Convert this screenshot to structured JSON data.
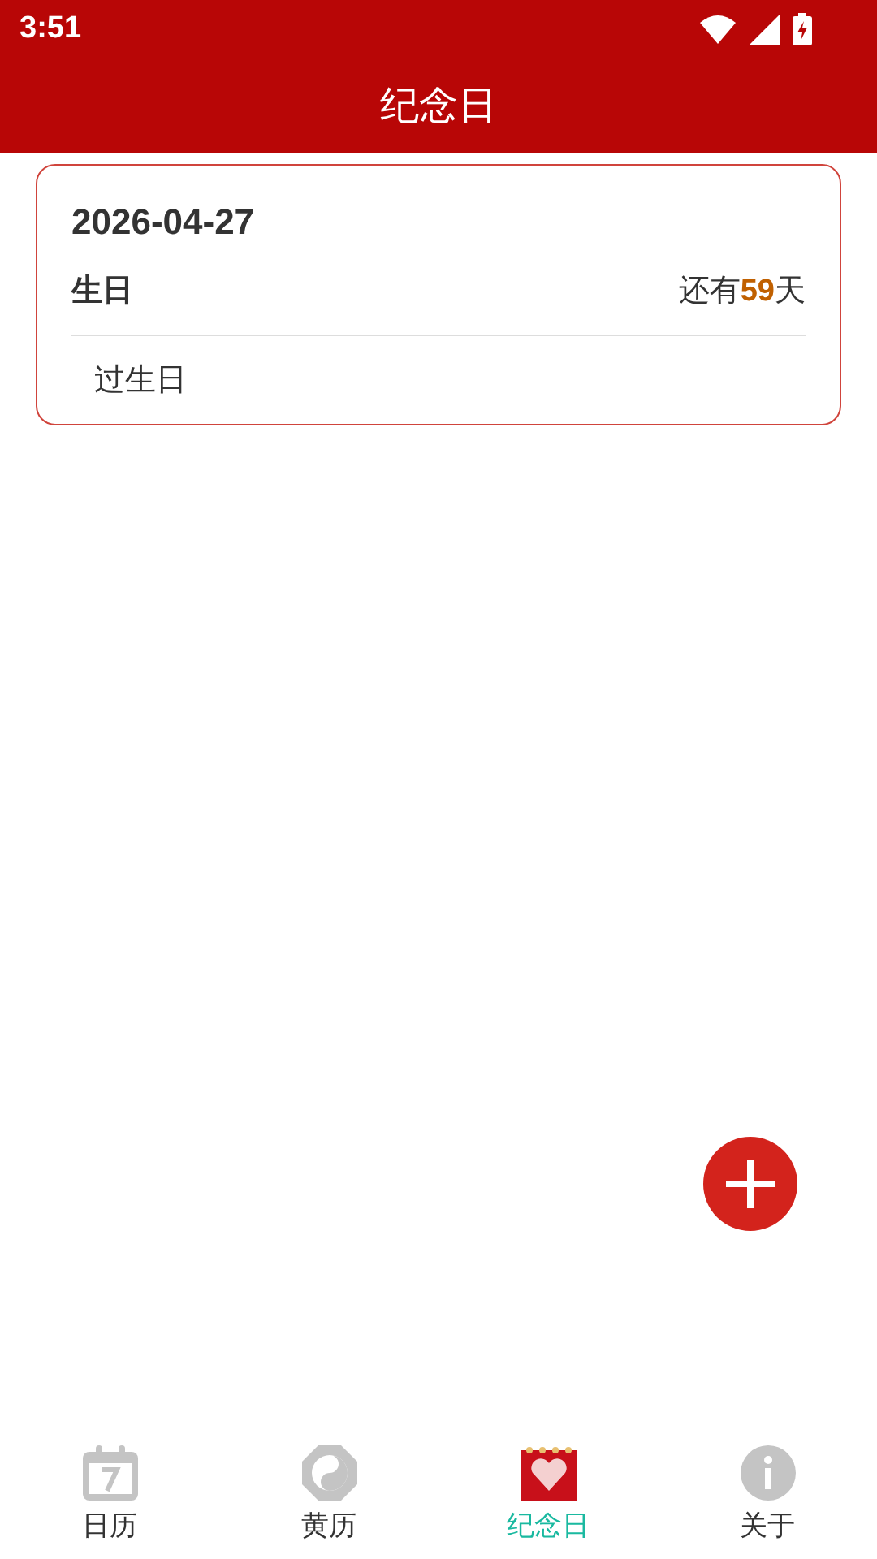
{
  "status_bar": {
    "time": "3:51"
  },
  "header": {
    "title": "纪念日"
  },
  "events": [
    {
      "date": "2026-04-27",
      "name": "生日",
      "countdown": {
        "prefix": "还有",
        "days": "59",
        "suffix": "天"
      },
      "note": "过生日"
    }
  ],
  "tabs": [
    {
      "label": "日历",
      "kind": "calendar",
      "selected": false
    },
    {
      "label": "黄历",
      "kind": "yinyang",
      "selected": false
    },
    {
      "label": "纪念日",
      "kind": "heart",
      "selected": true
    },
    {
      "label": "关于",
      "kind": "info",
      "selected": false
    }
  ]
}
